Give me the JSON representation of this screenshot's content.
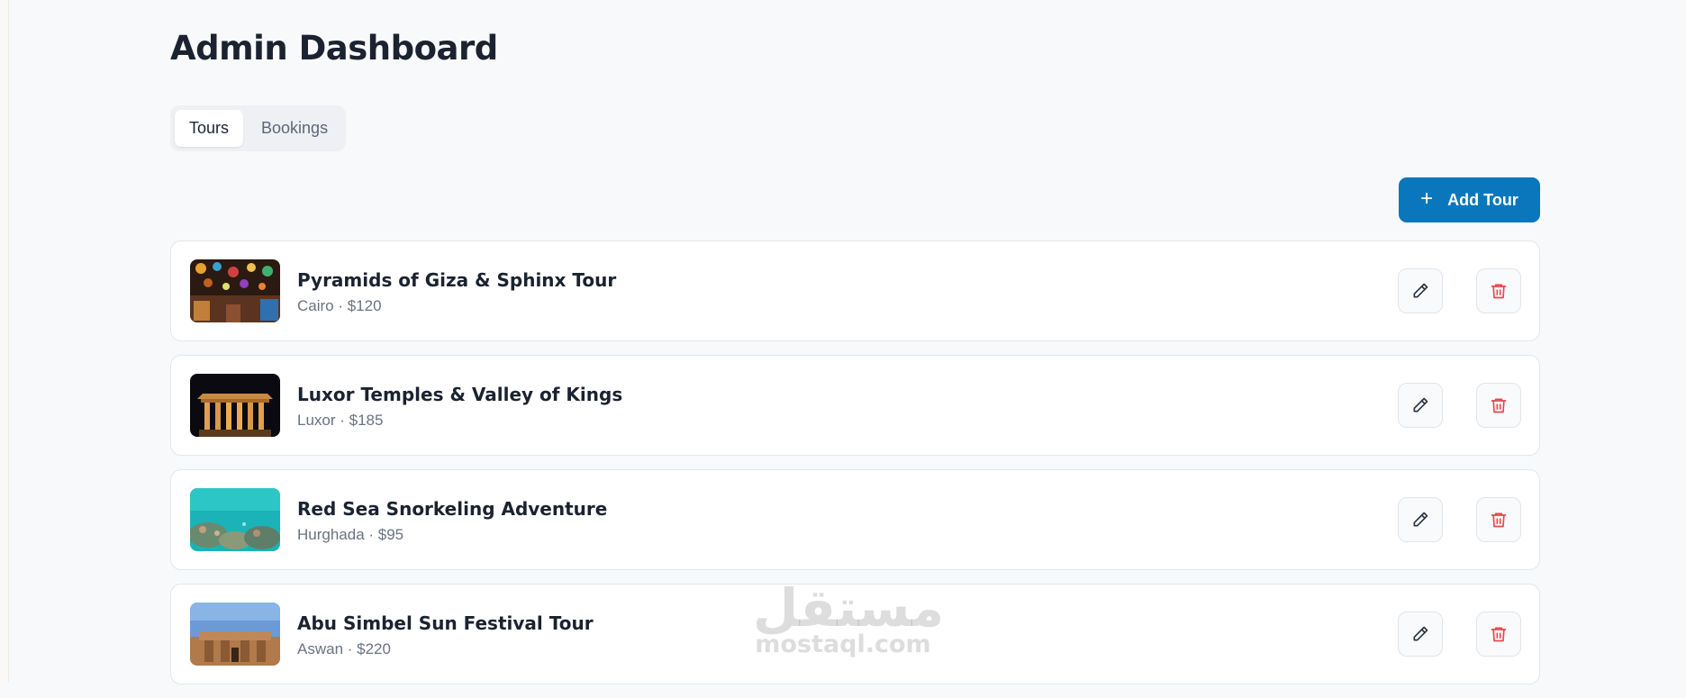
{
  "page": {
    "title": "Admin Dashboard"
  },
  "tabs": [
    {
      "label": "Tours",
      "active": true
    },
    {
      "label": "Bookings",
      "active": false
    }
  ],
  "actions": {
    "add_label": "Add Tour",
    "add_icon": "plus-icon"
  },
  "tours": [
    {
      "title": "Pyramids of Giza & Sphinx Tour",
      "meta": "Cairo · $120",
      "image": "lanterns-market"
    },
    {
      "title": "Luxor Temples & Valley of Kings",
      "meta": "Luxor · $185",
      "image": "lit-temple-night"
    },
    {
      "title": "Red Sea Snorkeling Adventure",
      "meta": "Hurghada · $95",
      "image": "coral-reef"
    },
    {
      "title": "Abu Simbel Sun Festival Tour",
      "meta": "Aswan · $220",
      "image": "abu-simbel-temple"
    }
  ],
  "row_actions": {
    "edit_icon": "pencil-icon",
    "delete_icon": "trash-icon"
  },
  "watermark": {
    "arabic": "مستقل",
    "latin": "mostaql.com"
  },
  "colors": {
    "accent": "#0a77bd",
    "danger": "#e5484d",
    "background": "#f8f9fa"
  }
}
